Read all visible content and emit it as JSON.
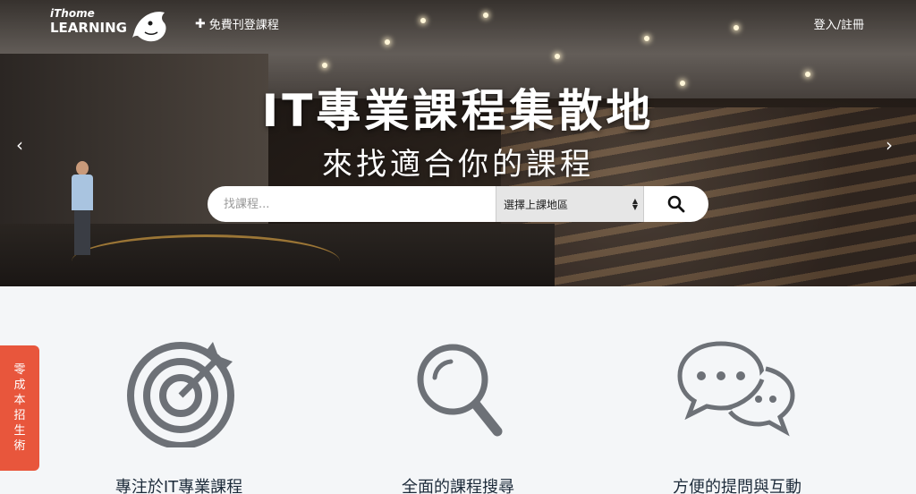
{
  "header": {
    "logo_small": "iThome",
    "logo_big": "LEARNING",
    "post_course_label": "免費刊登課程",
    "login_label": "登入/註冊"
  },
  "hero": {
    "title": "IT專業課程集散地",
    "subtitle": "來找適合你的課程",
    "prev_arrow": "‹",
    "next_arrow": "›"
  },
  "search": {
    "placeholder": "找課程...",
    "region_selected": "選擇上課地區"
  },
  "features": [
    {
      "icon": "target-icon",
      "label": "專注於IT專業課程"
    },
    {
      "icon": "magnifier-icon",
      "label": "全面的課程搜尋"
    },
    {
      "icon": "chat-bubbles-icon",
      "label": "方便的提問與互動"
    }
  ],
  "side_tab": {
    "chars": [
      "零",
      "成",
      "本",
      "招",
      "生",
      "術"
    ]
  },
  "colors": {
    "accent": "#e8563c",
    "icon_gray": "#6d7177",
    "background": "#f4f6f8"
  }
}
